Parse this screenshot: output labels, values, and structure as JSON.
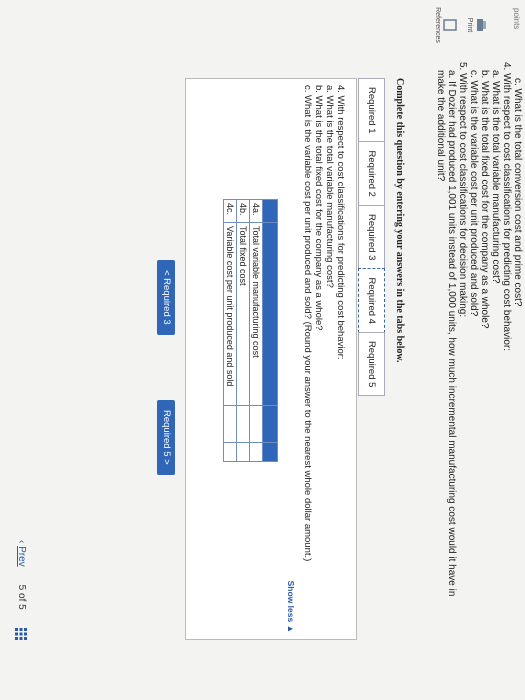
{
  "header": {
    "points_label": "points"
  },
  "rail": {
    "print_label": "Print",
    "references_label": "References"
  },
  "question": {
    "lines": [
      "c. What is the total conversion cost and prime cost?",
      "4. With respect to cost classifications for predicting cost behavior:",
      "a. What is the total variable manufacturing cost?",
      "b. What is the total fixed cost for the company as a whole?",
      "c. What is the variable cost per unit produced and sold?",
      "5. With respect to cost classifications for decision making:",
      "a. If Dozier had produced 1,001 units instead of 1,000 units, how much incremental manufacturing cost would it have in",
      "make the additional unit?"
    ]
  },
  "instructions": "Complete this question by entering your answers in the tabs below.",
  "tabs": [
    {
      "label": "Required 1"
    },
    {
      "label": "Required 2"
    },
    {
      "label": "Required 3"
    },
    {
      "label": "Required 4"
    },
    {
      "label": "Required 5"
    }
  ],
  "panel": {
    "lines": [
      "4. With respect to cost classifications for predicting cost behavior:",
      "a. What is the total variable manufacturing cost?",
      "b. What is the total fixed cost for the company as a whole?",
      "c. What is the variable cost per unit produced and sold? (Round your answer to the nearest whole dollar amount.)"
    ],
    "show_less": "Show less ▲",
    "table": {
      "rows": [
        {
          "label": "4a.",
          "desc": "Total variable manufacturing cost",
          "value": ""
        },
        {
          "label": "4b.",
          "desc": "Total fixed cost",
          "value": ""
        },
        {
          "label": "4c.",
          "desc": "Variable cost per unit produced and sold",
          "value": ""
        }
      ]
    },
    "prev_button": "<  Required 3",
    "next_button": "Required 5  >"
  },
  "pager": {
    "prev": "Prev",
    "position": "5 of 5"
  },
  "colors": {
    "accent": "#2f66b8"
  }
}
